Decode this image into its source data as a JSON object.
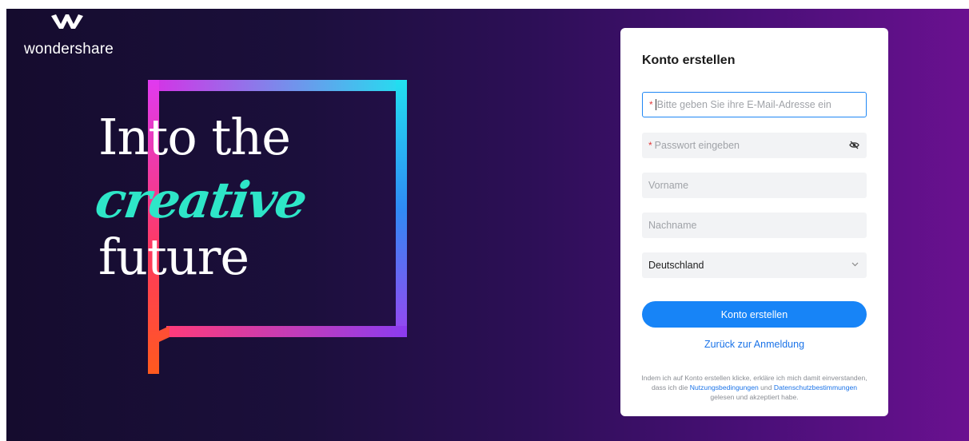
{
  "brand": {
    "name": "wondershare"
  },
  "hero": {
    "line1": "Into the",
    "line2": "creative",
    "line3": "future"
  },
  "form": {
    "title": "Konto erstellen",
    "email": {
      "placeholder": "Bitte geben Sie ihre E-Mail-Adresse ein",
      "required_mark": "*"
    },
    "password": {
      "placeholder": "Passwort eingeben",
      "required_mark": "*"
    },
    "first_name": {
      "placeholder": "Vorname"
    },
    "last_name": {
      "placeholder": "Nachname"
    },
    "country": {
      "selected": "Deutschland"
    },
    "submit_label": "Konto erstellen",
    "back_link": "Zurück zur Anmeldung",
    "legal": {
      "part1": "Indem ich auf Konto erstellen klicke, erkläre ich mich damit einverstanden, dass ich die ",
      "terms_link": "Nutzungsbedingungen",
      "part2": " und ",
      "privacy_link": "Datenschutzbestimmungen",
      "part3": " gelesen und akzeptiert habe."
    }
  },
  "colors": {
    "accent": "#1784f7",
    "link": "#1a73e8",
    "required": "#e23a3a",
    "creative_text": "#2ee6c8"
  }
}
